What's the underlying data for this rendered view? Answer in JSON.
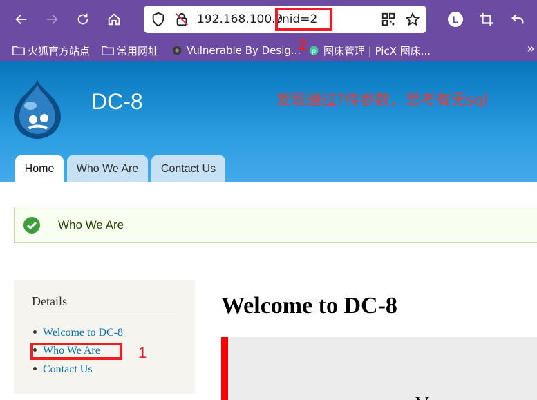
{
  "browser": {
    "url_host": "192.168.100.9",
    "url_query": "?nid=2",
    "account_initial": "L",
    "bookmarks": [
      "火狐官方站点",
      "常用网址",
      "Vulnerable By Desig...",
      "图床管理 | PicX 图床..."
    ],
    "annotation_number": "2",
    "more_indicator": "»"
  },
  "site": {
    "name": "DC-8",
    "annotation": "发现通过?传参数，思考有无sql",
    "tabs": [
      "Home",
      "Who We Are",
      "Contact Us"
    ]
  },
  "status": {
    "message": "Who We Are"
  },
  "sidebar": {
    "title": "Details",
    "items": [
      "Welcome to DC-8",
      "Who We Are",
      "Contact Us"
    ],
    "annotation_number": "1"
  },
  "main": {
    "title": "Welcome to DC-8",
    "partial_text": "V"
  },
  "colors": {
    "chrome": "#6c4ba3",
    "header": "#0876bd",
    "annotation_red": "#ee1c25",
    "link": "#0071b3"
  }
}
